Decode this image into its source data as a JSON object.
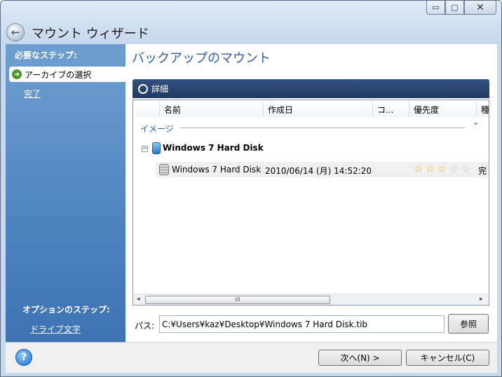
{
  "window": {
    "title": "マウント ウィザード",
    "caption": {
      "minimize": "▭",
      "maximize": "▢",
      "close": "✕"
    }
  },
  "sidebar": {
    "required_heading": "必要なステップ:",
    "steps": [
      {
        "label": "アーカイブの選択",
        "selected": true
      },
      {
        "label": "完了",
        "selected": false
      }
    ],
    "optional_heading": "オプションのステップ:",
    "optional_steps": [
      {
        "label": "ドライブ文字"
      }
    ]
  },
  "main": {
    "title": "バックアップのマウント",
    "section_label": "詳細",
    "columns": [
      "名前",
      "作成日",
      "コ...",
      "優先度",
      "種"
    ],
    "group": {
      "label": "イメージ",
      "collapse_glyph": "⌃"
    },
    "tree": {
      "toggle": "−",
      "node_label": "Windows 7 Hard Disk",
      "rows": [
        {
          "name": "Windows 7 Hard Disk",
          "date": "2010/06/14 (月) 14:52:20",
          "priority_stars": 3,
          "priority_max": 5,
          "status": "完"
        }
      ]
    },
    "scroll": {
      "left": "◂",
      "right": "▸",
      "grip": "III"
    },
    "path": {
      "label": "パス:",
      "value": "C:¥Users¥kaz¥Desktop¥Windows 7 Hard Disk.tib"
    },
    "browse_label": "参照"
  },
  "footer": {
    "help_glyph": "?",
    "next_label": "次へ(N) >",
    "cancel_label": "キャンセル(C)"
  },
  "colors": {
    "accent": "#2c5ea8",
    "sidebar": "#4d84c0",
    "section_bar": "#1e3a64",
    "star_on": "#e8b80c"
  }
}
